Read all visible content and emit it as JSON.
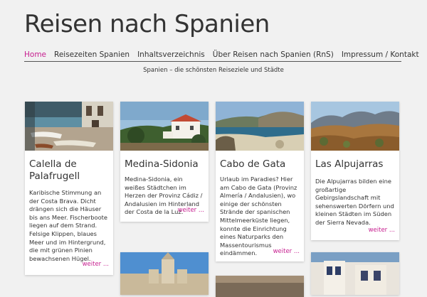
{
  "site": {
    "title": "Reisen nach Spanien",
    "tagline": "Spanien – die schönsten Reiseziele und Städte"
  },
  "nav": [
    {
      "label": "Home",
      "active": true
    },
    {
      "label": "Reisezeiten Spanien",
      "active": false
    },
    {
      "label": "Inhaltsverzeichnis",
      "active": false
    },
    {
      "label": "Über Reisen nach Spanien (RnS)",
      "active": false
    },
    {
      "label": "Impressum / Kontakt",
      "active": false
    }
  ],
  "cards": [
    {
      "title": "Calella de Palafrugell",
      "text": "Karibische Stimmung an der Costa Brava. Dicht drängen sich die Häuser bis ans Meer. Fischerboote liegen auf dem Strand. Felsige Klippen, blaues Meer und im Hintergrund, die mit grünen Pinien bewachsenen Hügel.",
      "more": "weiter ..."
    },
    {
      "title": "Medina-Sidonia",
      "text": "Medina-Sidonia, ein weißes Städtchen im Herzen der Provinz Cádiz / Andalusien im Hinterland der Costa de la Luz.",
      "more": "weiter ..."
    },
    {
      "title": "Cabo de Gata",
      "text": "Urlaub im Paradies? Hier am Cabo de Gata (Provinz Almería / Andalusien), wo einige der schönsten Strände der spanischen Mittelmeerküste liegen, konnte die Einrichtung eines Naturparks den Massentourismus eindämmen.",
      "more": "weiter ..."
    },
    {
      "title": "Las Alpujarras",
      "text": "Die Alpujarras bilden eine großartige Gebirgslandschaft mit sehenswerten Dörfern und kleinen Städten im Süden der Sierra Nevada.",
      "more": "weiter ..."
    }
  ],
  "colors": {
    "accent": "#c61e8f",
    "background": "#f1f1f1",
    "text": "#333333"
  }
}
